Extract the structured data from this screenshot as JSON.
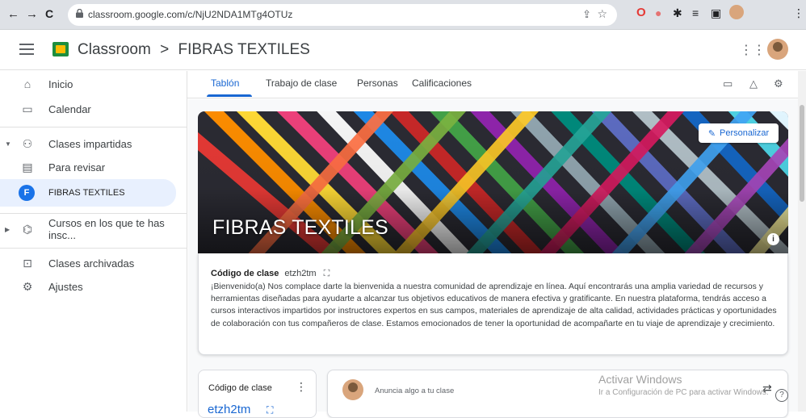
{
  "browser": {
    "url": "classroom.google.com/c/NjU2NDA1MTg4OTUz",
    "back_icon": "←",
    "forward_icon": "→",
    "reload_icon": "C"
  },
  "appbar": {
    "app_name": "Classroom",
    "separator": ">",
    "class_name": "FIBRAS TEXTILES"
  },
  "sidebar": {
    "items": [
      {
        "label": "Inicio",
        "icon": "home-icon"
      },
      {
        "label": "Calendar",
        "icon": "calendar-icon"
      },
      {
        "label": "Clases impartidas",
        "icon": "people-icon"
      },
      {
        "label": "Para revisar",
        "icon": "review-icon"
      },
      {
        "label": "FIBRAS TEXTILES",
        "avatar_letter": "F",
        "active": true
      },
      {
        "label": "Cursos en los que te has insc...",
        "icon": "school-icon"
      },
      {
        "label": "Clases archivadas",
        "icon": "archive-icon"
      },
      {
        "label": "Ajustes",
        "icon": "gear-icon"
      }
    ]
  },
  "tabs": [
    {
      "label": "Tablón",
      "active": true
    },
    {
      "label": "Trabajo de clase"
    },
    {
      "label": "Personas"
    },
    {
      "label": "Calificaciones"
    }
  ],
  "banner": {
    "title": "FIBRAS TEXTILES",
    "customize_label": "Personalizar",
    "info_icon": "i"
  },
  "class_info": {
    "code_label": "Código de clase",
    "code_value": "etzh2tm",
    "description": "¡Bienvenido(a) Nos complace darte la bienvenida a nuestra comunidad de aprendizaje en línea. Aquí encontrarás una amplia variedad de recursos y herramientas diseñadas para ayudarte a alcanzar tus objetivos educativos de manera efectiva y gratificante. En nuestra plataforma, tendrás acceso a cursos interactivos impartidos por instructores expertos en sus campos, materiales de aprendizaje de alta calidad, actividades prácticas y oportunidades de colaboración con tus compañeros de clase. Estamos emocionados de tener la oportunidad de acompañarte en tu viaje de aprendizaje y crecimiento."
  },
  "code_card": {
    "title": "Código de clase",
    "value": "etzh2tm",
    "menu_icon": "⋮"
  },
  "announce": {
    "placeholder": "Anuncia algo a tu clase"
  },
  "watermark": {
    "line1": "Activar Windows",
    "line2": "Ir a Configuración de PC para activar Windows."
  },
  "help_icon": "?",
  "colors": {
    "accent": "#1967d2",
    "active_nav_bg": "#e8f0fe",
    "logo_green": "#1e8e3e",
    "logo_yellow": "#fbbc04"
  }
}
